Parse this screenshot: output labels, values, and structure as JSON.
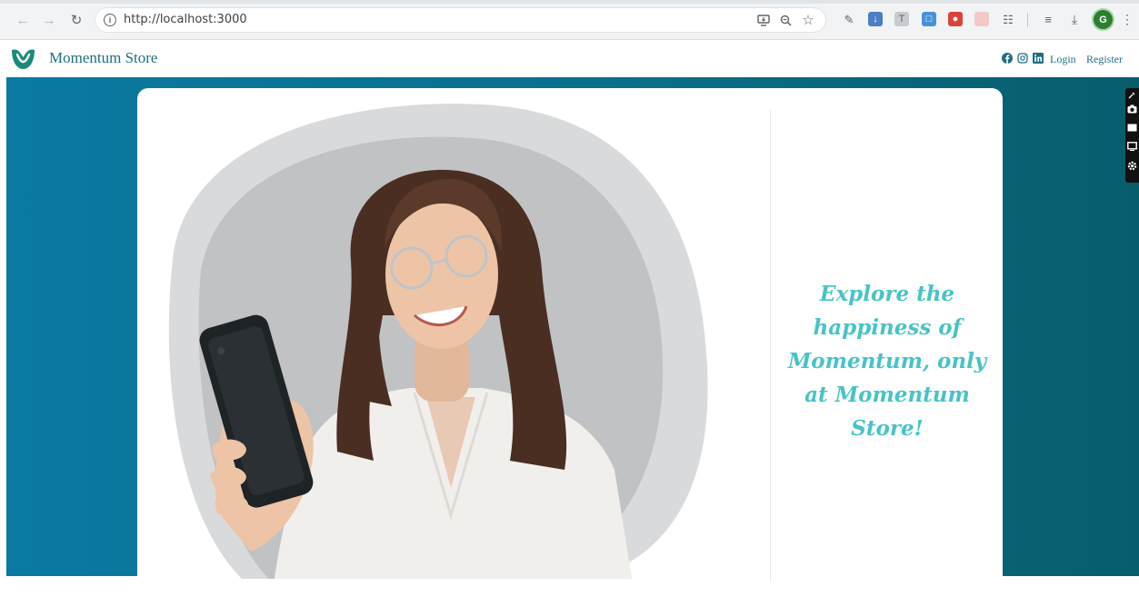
{
  "browser": {
    "url": "http://localhost:3000",
    "icons": {
      "back": "arrow-left-icon",
      "forward": "arrow-right-icon",
      "reload": "reload-icon",
      "site_info": "info-icon",
      "install": "install-app-icon",
      "zoom": "zoom-icon",
      "bookmark": "star-icon",
      "profile_initial": "G"
    }
  },
  "header": {
    "brand_name": "Momentum Store",
    "login_label": "Login",
    "register_label": "Register",
    "social_icons": [
      "facebook-icon",
      "instagram-icon",
      "linkedin-icon"
    ]
  },
  "hero": {
    "tagline": "Explore the happiness of Momentum, only at Momentum Store!"
  },
  "colors": {
    "brand": "#1f6e83",
    "hero_background_start": "#0a7aa2",
    "hero_background_end": "#075d6c",
    "tagline": "#48c3c8",
    "logo_green": "#1a8a7a"
  }
}
